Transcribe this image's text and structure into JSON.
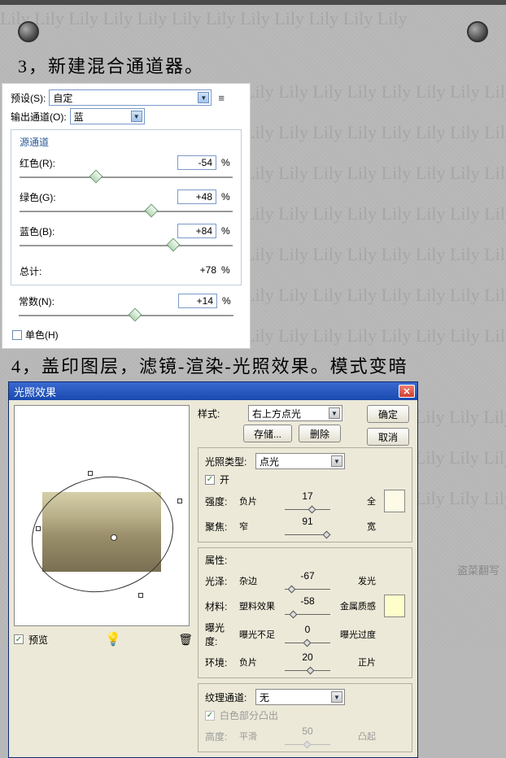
{
  "headings": {
    "step3": "3，新建混合通道器。",
    "step4": "4，盖印图层，滤镜-渲染-光照效果。模式变暗"
  },
  "channelMixer": {
    "presetLabel": "预设(S):",
    "presetValue": "自定",
    "outChannelLabel": "输出通道(O):",
    "outChannelValue": "蓝",
    "sourceTitle": "源通道",
    "red": {
      "label": "红色(R):",
      "value": "-54",
      "thumbPos": 36
    },
    "green": {
      "label": "绿色(G):",
      "value": "+48",
      "thumbPos": 62
    },
    "blue": {
      "label": "蓝色(B):",
      "value": "+84",
      "thumbPos": 72
    },
    "totalLabel": "总计:",
    "totalValue": "+78",
    "constant": {
      "label": "常数(N):",
      "value": "+14",
      "thumbPos": 54
    },
    "pct": "%",
    "monoLabel": "单色(H)"
  },
  "lightingFx": {
    "title": "光照效果",
    "okBtn": "确定",
    "cancelBtn": "取消",
    "styleLabel": "样式:",
    "styleValue": "右上方点光",
    "saveBtn": "存储...",
    "deleteBtn": "删除",
    "lightTypeLabel": "光照类型:",
    "lightTypeValue": "点光",
    "onLabel": "开",
    "intensity": {
      "label": "强度:",
      "left": "负片",
      "value": "17",
      "right": "全",
      "pos": 60
    },
    "focus": {
      "label": "聚焦:",
      "left": "窄",
      "value": "91",
      "right": "宽",
      "pos": 92
    },
    "propsTitle": "属性:",
    "gloss": {
      "label": "光泽:",
      "left": "杂边",
      "value": "-67",
      "right": "发光",
      "pos": 16
    },
    "material": {
      "label": "材料:",
      "left": "塑料效果",
      "value": "-58",
      "right": "金属质感",
      "pos": 20
    },
    "exposure": {
      "label": "曝光度:",
      "left": "曝光不足",
      "value": "0",
      "right": "曝光过度",
      "pos": 50
    },
    "ambience": {
      "label": "环境:",
      "left": "负片",
      "value": "20",
      "right": "正片",
      "pos": 58
    },
    "textureChannelLabel": "纹理通道:",
    "textureChannelValue": "无",
    "whiteHighLabel": "白色部分凸出",
    "height": {
      "label": "高度:",
      "left": "平滑",
      "value": "50",
      "right": "凸起",
      "pos": 50
    },
    "swatch1": "#fdfbe5",
    "swatch2": "#fefecb",
    "previewLabel": "预览"
  },
  "watermark": "Lily Lily Lily Lily Lily Lily Lily Lily Lily Lily Lily Lily",
  "copyNote": "盗菜翻写"
}
